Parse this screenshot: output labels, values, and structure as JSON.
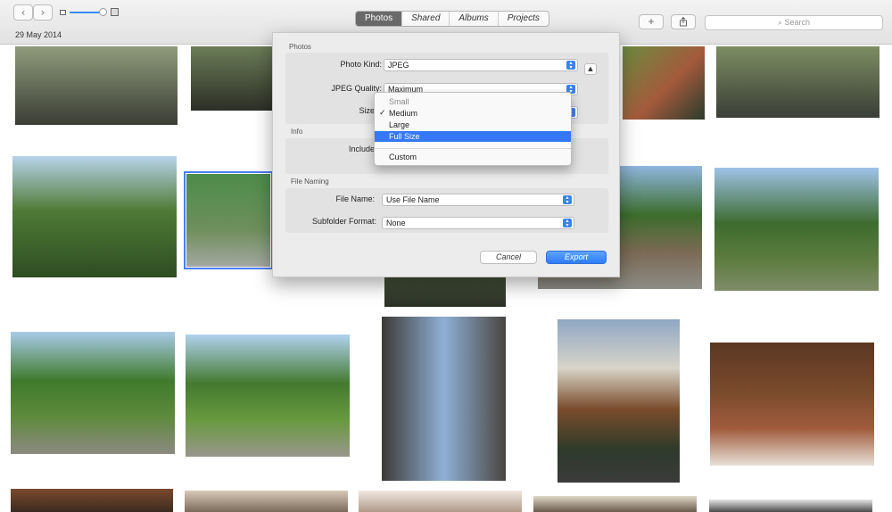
{
  "toolbar": {
    "back_icon": "chevron-left-icon",
    "forward_icon": "chevron-right-icon",
    "zoom_level": 0.85,
    "tabs": [
      {
        "label": "Photos",
        "active": true
      },
      {
        "label": "Shared",
        "active": false
      },
      {
        "label": "Albums",
        "active": false
      },
      {
        "label": "Projects",
        "active": false
      }
    ],
    "add_icon": "plus-icon",
    "share_icon": "share-icon",
    "search_placeholder": "Search"
  },
  "library": {
    "date": "29 May 2014"
  },
  "export_dialog": {
    "photos_section": "Photos",
    "photo_kind_label": "Photo Kind:",
    "photo_kind_value": "JPEG",
    "jpeg_quality_label": "JPEG Quality:",
    "jpeg_quality_value": "Maximum",
    "size_label": "Size",
    "info_section": "Info",
    "include_label": "Include",
    "file_naming_section": "File Naming",
    "file_name_label": "File Name:",
    "file_name_value": "Use File Name",
    "subfolder_label": "Subfolder Format:",
    "subfolder_value": "None",
    "cancel_label": "Cancel",
    "export_label": "Export",
    "accent_color": "#3478f6"
  },
  "size_menu": {
    "options": [
      "Small",
      "Medium",
      "Large",
      "Full Size",
      "Custom"
    ],
    "checked": "Medium",
    "highlighted": "Full Size"
  }
}
